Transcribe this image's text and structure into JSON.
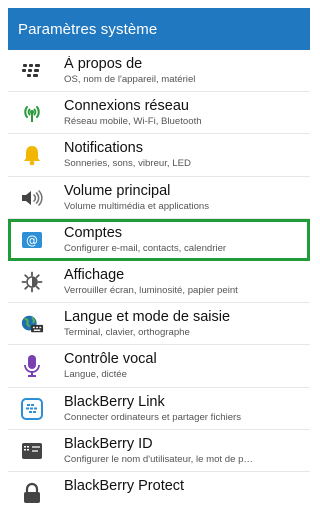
{
  "header": {
    "title": "Paramètres système"
  },
  "items": [
    {
      "id": "about",
      "title": "À propos de",
      "subtitle": "OS, nom de l'appareil, matériel",
      "icon": "bb-dots-icon"
    },
    {
      "id": "network",
      "title": "Connexions réseau",
      "subtitle": "Réseau mobile, Wi-Fi, Bluetooth",
      "icon": "antenna-icon"
    },
    {
      "id": "notifications",
      "title": "Notifications",
      "subtitle": "Sonneries, sons, vibreur, LED",
      "icon": "bell-icon"
    },
    {
      "id": "volume",
      "title": "Volume principal",
      "subtitle": "Volume multimédia et applications",
      "icon": "speaker-icon"
    },
    {
      "id": "accounts",
      "title": "Comptes",
      "subtitle": "Configurer e-mail, contacts, calendrier",
      "icon": "at-icon",
      "selected": true
    },
    {
      "id": "display",
      "title": "Affichage",
      "subtitle": "Verrouiller écran, luminosité, papier peint",
      "icon": "brightness-icon"
    },
    {
      "id": "language",
      "title": "Langue et mode de saisie",
      "subtitle": "Terminal, clavier, orthographe",
      "icon": "globe-keyboard-icon"
    },
    {
      "id": "voice",
      "title": "Contrôle vocal",
      "subtitle": "Langue, dictée",
      "icon": "microphone-icon"
    },
    {
      "id": "bblink",
      "title": "BlackBerry Link",
      "subtitle": "Connecter ordinateurs et partager fichiers",
      "icon": "bb-link-icon"
    },
    {
      "id": "bbid",
      "title": "BlackBerry ID",
      "subtitle": "Configurer le nom d'utilisateur, le mot de p…",
      "icon": "id-card-icon"
    },
    {
      "id": "bbprotect",
      "title": "BlackBerry Protect",
      "subtitle": "",
      "icon": "lock-icon"
    }
  ],
  "colors": {
    "header": "#1f78c0",
    "selection": "#1f9b3a"
  }
}
